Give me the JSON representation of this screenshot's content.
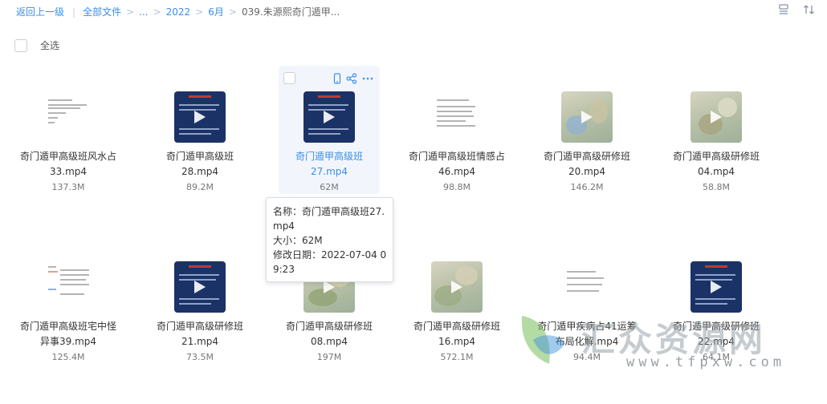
{
  "breadcrumb": {
    "back": "返回上一级",
    "divider": "|",
    "items": [
      "全部文件",
      "...",
      "2022",
      "6月",
      "039.朱源熙奇门遁甲..."
    ],
    "separator": ">"
  },
  "toolbar": {
    "icons": [
      "list-view-icon",
      "sort-icon"
    ]
  },
  "select_all": {
    "label": "全选"
  },
  "files": [
    {
      "name": "奇门遁甲高级班风水占33.mp4",
      "size": "137.3M",
      "thumb": "doc"
    },
    {
      "name": "奇门遁甲高级班28.mp4",
      "size": "89.2M",
      "thumb": "video"
    },
    {
      "name": "奇门遁甲高级班27.mp4",
      "size": "62M",
      "thumb": "video",
      "hovered": true
    },
    {
      "name": "奇门遁甲高级班情感占46.mp4",
      "size": "98.8M",
      "thumb": "doc"
    },
    {
      "name": "奇门遁甲高级研修班20.mp4",
      "size": "146.2M",
      "thumb": "scene"
    },
    {
      "name": "奇门遁甲高级研修班04.mp4",
      "size": "58.8M",
      "thumb": "scene"
    },
    {
      "name": "奇门遁甲高级班宅中怪异事39.mp4",
      "size": "125.4M",
      "thumb": "doc"
    },
    {
      "name": "奇门遁甲高级研修班21.mp4",
      "size": "73.5M",
      "thumb": "video"
    },
    {
      "name": "奇门遁甲高级研修班08.mp4",
      "size": "197M",
      "thumb": "scene"
    },
    {
      "name": "奇门遁甲高级研修班16.mp4",
      "size": "572.1M",
      "thumb": "scene"
    },
    {
      "name": "奇门遁甲疾病占41运筹布局化解.mp4",
      "size": "94.4M",
      "thumb": "doc"
    },
    {
      "name": "奇门遁甲高级研修班22.mp4",
      "size": "64.1M",
      "thumb": "video"
    }
  ],
  "card_actions": [
    "phone-icon",
    "share-icon",
    "more-icon"
  ],
  "tooltip": {
    "name_line": "名称：奇门遁甲高级班27.mp4",
    "size_line": "大小：62M",
    "date_line": "修改日期：2022-07-04 09:23"
  },
  "watermark": {
    "text": "汇众资源网",
    "url": "www.tfpxw.com"
  }
}
